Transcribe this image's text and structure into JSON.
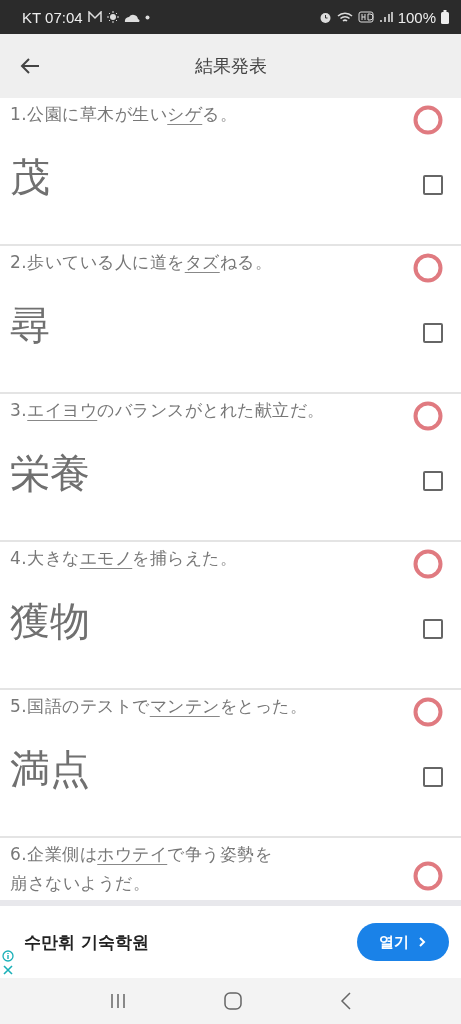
{
  "status_bar": {
    "carrier_time": "KT 07:04",
    "battery": "100%"
  },
  "header": {
    "title": "結果発表"
  },
  "questions": [
    {
      "number": "1.",
      "before": "公園に草木が生い",
      "underlined": "シゲ",
      "after": "る。",
      "correct": true,
      "answer": "茂",
      "checked": false
    },
    {
      "number": "2.",
      "before": "歩いている人に道を",
      "underlined": "タズ",
      "after": "ねる。",
      "correct": true,
      "answer": "尋",
      "checked": false
    },
    {
      "number": "3.",
      "underlined": "エイヨウ",
      "after": "のバランスがとれた献立だ。",
      "correct": true,
      "answer": "栄養",
      "checked": false
    },
    {
      "number": "4.",
      "before": "大きな",
      "underlined": "エモノ",
      "after": "を捕らえた。",
      "correct": true,
      "answer": "獲物",
      "checked": false
    },
    {
      "number": "5.",
      "before": "国語のテストで",
      "underlined": "マンテン",
      "after": "をとった。",
      "correct": true,
      "answer": "満点",
      "checked": false
    },
    {
      "number": "6.",
      "before": "企業側は",
      "underlined": "ホウテイ",
      "after": "で争う姿勢を",
      "continuation": "崩さないようだ。",
      "correct": true
    }
  ],
  "ad": {
    "title": "수만휘 기숙학원",
    "button": "열기"
  }
}
